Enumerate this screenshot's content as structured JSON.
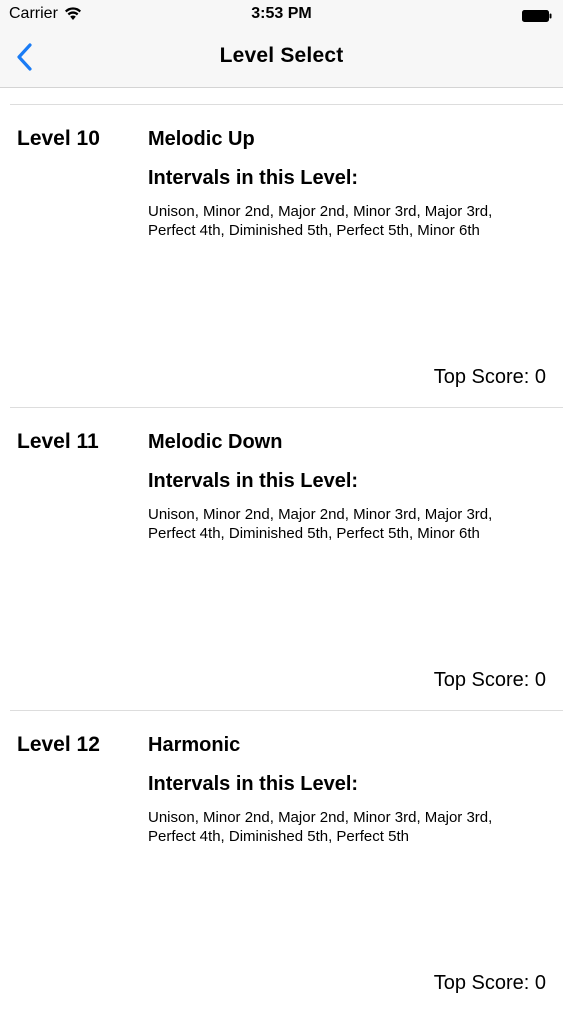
{
  "status_bar": {
    "carrier": "Carrier",
    "time": "3:53 PM"
  },
  "nav": {
    "title": "Level Select",
    "back_icon": "chevron-left-icon",
    "accent_color": "#1a7cf5"
  },
  "levels": [
    {
      "level": "Level 10",
      "mode": "Melodic Up",
      "intervals_heading": "Intervals in this Level:",
      "intervals": "Unison, Minor 2nd, Major 2nd, Minor 3rd, Major 3rd, Perfect 4th, Diminished 5th, Perfect 5th, Minor 6th",
      "top_score": "Top Score: 0"
    },
    {
      "level": "Level 11",
      "mode": "Melodic Down",
      "intervals_heading": "Intervals in this Level:",
      "intervals": "Unison, Minor 2nd, Major 2nd, Minor 3rd, Major 3rd, Perfect 4th, Diminished 5th, Perfect 5th, Minor 6th",
      "top_score": "Top Score: 0"
    },
    {
      "level": "Level 12",
      "mode": "Harmonic",
      "intervals_heading": "Intervals in this Level:",
      "intervals": "Unison, Minor 2nd, Major 2nd, Minor 3rd, Major 3rd, Perfect 4th, Diminished 5th, Perfect 5th",
      "top_score": "Top Score: 0"
    }
  ]
}
